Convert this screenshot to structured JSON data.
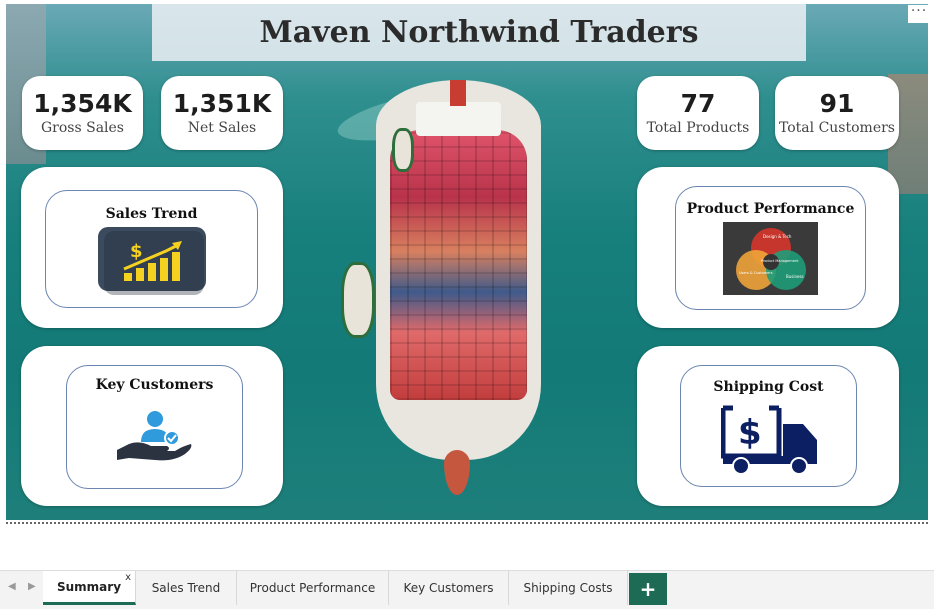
{
  "report": {
    "title": "Maven Northwind Traders",
    "more_label": "···"
  },
  "kpis": [
    {
      "value": "1,354K",
      "label": "Gross Sales"
    },
    {
      "value": "1,351K",
      "label": "Net Sales"
    },
    {
      "value": "77",
      "label": "Total Products"
    },
    {
      "value": "91",
      "label": "Total Customers"
    }
  ],
  "cards": {
    "sales_trend": {
      "title": "Sales Trend",
      "icon": "sales-trend-chart-icon"
    },
    "product_performance": {
      "title": "Product Performance",
      "icon": "venn-product-management-icon",
      "venn_labels": [
        "Design & Tech",
        "Product Management",
        "Users & Customers",
        "Business"
      ]
    },
    "key_customers": {
      "title": "Key Customers",
      "icon": "customer-hand-icon"
    },
    "shipping_cost": {
      "title": "Shipping Cost",
      "icon": "delivery-truck-dollar-icon"
    }
  },
  "tabs": {
    "items": [
      {
        "label": "Summary",
        "active": true,
        "close": "x"
      },
      {
        "label": "Sales Trend"
      },
      {
        "label": "Product Performance"
      },
      {
        "label": "Key Customers"
      },
      {
        "label": "Shipping Costs"
      }
    ],
    "add_label": "+",
    "prev_arrow": "◀",
    "next_arrow": "▶"
  },
  "colors": {
    "accent": "#1d6b55",
    "sea": "#177f7c",
    "card_border": "#6b86b0"
  }
}
